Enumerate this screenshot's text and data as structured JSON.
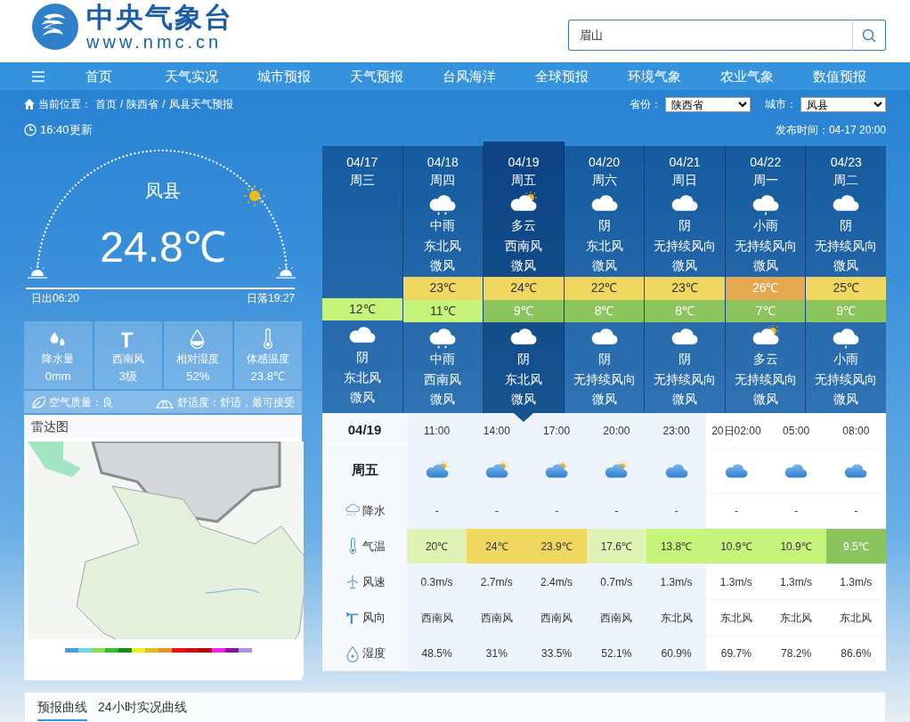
{
  "header": {
    "title": "中央气象台",
    "site": "www.nmc.cn",
    "search": {
      "value": "眉山"
    }
  },
  "nav": {
    "items": [
      "首页",
      "天气实况",
      "城市预报",
      "天气预报",
      "台风海洋",
      "全球预报",
      "环境气象",
      "农业气象",
      "数值预报"
    ]
  },
  "breadcrumb": {
    "label": "当前位置：",
    "separator": "/",
    "items": [
      "首页",
      "陕西省",
      "凤县天气预报"
    ]
  },
  "selectors": [
    {
      "label": "省份：",
      "value": "陕西省"
    },
    {
      "label": "城市：",
      "value": "凤县"
    }
  ],
  "updated": "16:40更新",
  "published": "发布时间：04-17 20:00",
  "current": {
    "city": "凤县",
    "temperature": "24.8℃",
    "sunrise": "日出06:20",
    "sunset": "日落19:27"
  },
  "stats": [
    {
      "kind": "precipitation",
      "label": "降水量",
      "value": "0mm"
    },
    {
      "kind": "wind",
      "label": "西南风",
      "value": "3级"
    },
    {
      "kind": "humidity",
      "label": "相对湿度",
      "value": "52%"
    },
    {
      "kind": "feels_like",
      "label": "体感温度",
      "value": "23.8℃"
    }
  ],
  "air_quality": "空气质量：良",
  "comfort": "舒适度：舒适，最可接受",
  "radar": {
    "title": "雷达图"
  },
  "daily": [
    {
      "date": "04/17",
      "weekday": "周三",
      "selected": false,
      "low": {
        "text": "12℃",
        "color": "#c6f37a"
      },
      "night": {
        "kind": "overcast",
        "weather": "阴",
        "wind": "东北风",
        "level": "微风"
      }
    },
    {
      "date": "04/18",
      "weekday": "周四",
      "selected": false,
      "day": {
        "kind": "rain",
        "weather": "中雨",
        "wind": "东北风",
        "level": "微风"
      },
      "high": {
        "text": "23℃",
        "color": "#f0d860"
      },
      "low": {
        "text": "11℃",
        "color": "#c6f37a"
      },
      "night": {
        "kind": "rain",
        "weather": "中雨",
        "wind": "西南风",
        "level": "微风"
      }
    },
    {
      "date": "04/19",
      "weekday": "周五",
      "selected": true,
      "day": {
        "kind": "partly_cloudy",
        "weather": "多云",
        "wind": "西南风",
        "level": "微风"
      },
      "high": {
        "text": "24℃",
        "color": "#f0d860"
      },
      "low": {
        "text": "9℃",
        "color": "#8cc55e"
      },
      "night": {
        "kind": "overcast",
        "weather": "阴",
        "wind": "东北风",
        "level": "微风"
      }
    },
    {
      "date": "04/20",
      "weekday": "周六",
      "selected": false,
      "day": {
        "kind": "overcast",
        "weather": "阴",
        "wind": "东北风",
        "level": "微风"
      },
      "high": {
        "text": "22℃",
        "color": "#f0d860"
      },
      "low": {
        "text": "8℃",
        "color": "#8cc55e"
      },
      "night": {
        "kind": "overcast",
        "weather": "阴",
        "wind": "无持续风向",
        "level": "微风"
      }
    },
    {
      "date": "04/21",
      "weekday": "周日",
      "selected": false,
      "day": {
        "kind": "overcast",
        "weather": "阴",
        "wind": "无持续风向",
        "level": "微风"
      },
      "high": {
        "text": "23℃",
        "color": "#f0d860"
      },
      "low": {
        "text": "8℃",
        "color": "#8cc55e"
      },
      "night": {
        "kind": "overcast",
        "weather": "阴",
        "wind": "无持续风向",
        "level": "微风"
      }
    },
    {
      "date": "04/22",
      "weekday": "周一",
      "selected": false,
      "day": {
        "kind": "light_rain",
        "weather": "小雨",
        "wind": "无持续风向",
        "level": "微风"
      },
      "high": {
        "text": "26℃",
        "color": "#e5a84f"
      },
      "low": {
        "text": "7℃",
        "color": "#8cc55e"
      },
      "night": {
        "kind": "partly_cloudy",
        "weather": "多云",
        "wind": "无持续风向",
        "level": "微风"
      }
    },
    {
      "date": "04/23",
      "weekday": "周二",
      "selected": false,
      "day": {
        "kind": "overcast",
        "weather": "阴",
        "wind": "无持续风向",
        "level": "微风"
      },
      "high": {
        "text": "25℃",
        "color": "#f0d860"
      },
      "low": {
        "text": "9℃",
        "color": "#8cc55e"
      },
      "night": {
        "kind": "light_rain",
        "weather": "小雨",
        "wind": "无持续风向",
        "level": "微风"
      }
    }
  ],
  "hourly": {
    "date": "04/19",
    "weekday": "周五",
    "row_labels": [
      {
        "kind": "precipitation",
        "label": "降水"
      },
      {
        "kind": "temperature",
        "label": "气温"
      },
      {
        "kind": "wind_speed",
        "label": "风速"
      },
      {
        "kind": "wind_direction",
        "label": "风向"
      },
      {
        "kind": "humidity",
        "label": "湿度"
      }
    ],
    "hours": [
      {
        "time": "11:00",
        "kind": "partly_cloudy",
        "highlighted": true,
        "precipitation": "-",
        "temperature": "20℃",
        "color": "#dff3b5",
        "wind_speed": "0.3m/s",
        "wind_direction": "西南风",
        "humidity": "48.5%"
      },
      {
        "time": "14:00",
        "kind": "partly_cloudy",
        "highlighted": true,
        "precipitation": "-",
        "temperature": "24℃",
        "color": "#f0d860",
        "wind_speed": "2.7m/s",
        "wind_direction": "西南风",
        "humidity": "31%"
      },
      {
        "time": "17:00",
        "kind": "partly_cloudy",
        "highlighted": true,
        "precipitation": "-",
        "temperature": "23.9℃",
        "color": "#f0d860",
        "wind_speed": "2.4m/s",
        "wind_direction": "西南风",
        "humidity": "33.5%"
      },
      {
        "time": "20:00",
        "kind": "partly_cloudy",
        "highlighted": true,
        "precipitation": "-",
        "temperature": "17.6℃",
        "color": "#dff3b5",
        "wind_speed": "0.7m/s",
        "wind_direction": "西南风",
        "humidity": "52.1%"
      },
      {
        "time": "23:00",
        "kind": "cloudy",
        "highlighted": true,
        "precipitation": "-",
        "temperature": "13.8℃",
        "color": "#c6f37a",
        "wind_speed": "1.3m/s",
        "wind_direction": "东北风",
        "humidity": "60.9%"
      },
      {
        "time": "20日02:00",
        "kind": "cloudy",
        "highlighted": false,
        "precipitation": "-",
        "temperature": "10.9℃",
        "color": "#c6f37a",
        "wind_speed": "1.3m/s",
        "wind_direction": "东北风",
        "humidity": "69.7%"
      },
      {
        "time": "05:00",
        "kind": "cloudy",
        "highlighted": false,
        "precipitation": "-",
        "temperature": "10.9℃",
        "color": "#c6f37a",
        "wind_speed": "1.3m/s",
        "wind_direction": "东北风",
        "humidity": "78.2%"
      },
      {
        "time": "08:00",
        "kind": "cloudy",
        "highlighted": false,
        "precipitation": "-",
        "temperature": "9.5℃",
        "color": "#8cc55e",
        "wind_speed": "1.3m/s",
        "wind_direction": "东北风",
        "humidity": "86.6%"
      }
    ]
  },
  "tabs": [
    {
      "label": "预报曲线",
      "selected": true
    },
    {
      "label": "24小时实况曲线",
      "selected": false
    }
  ]
}
